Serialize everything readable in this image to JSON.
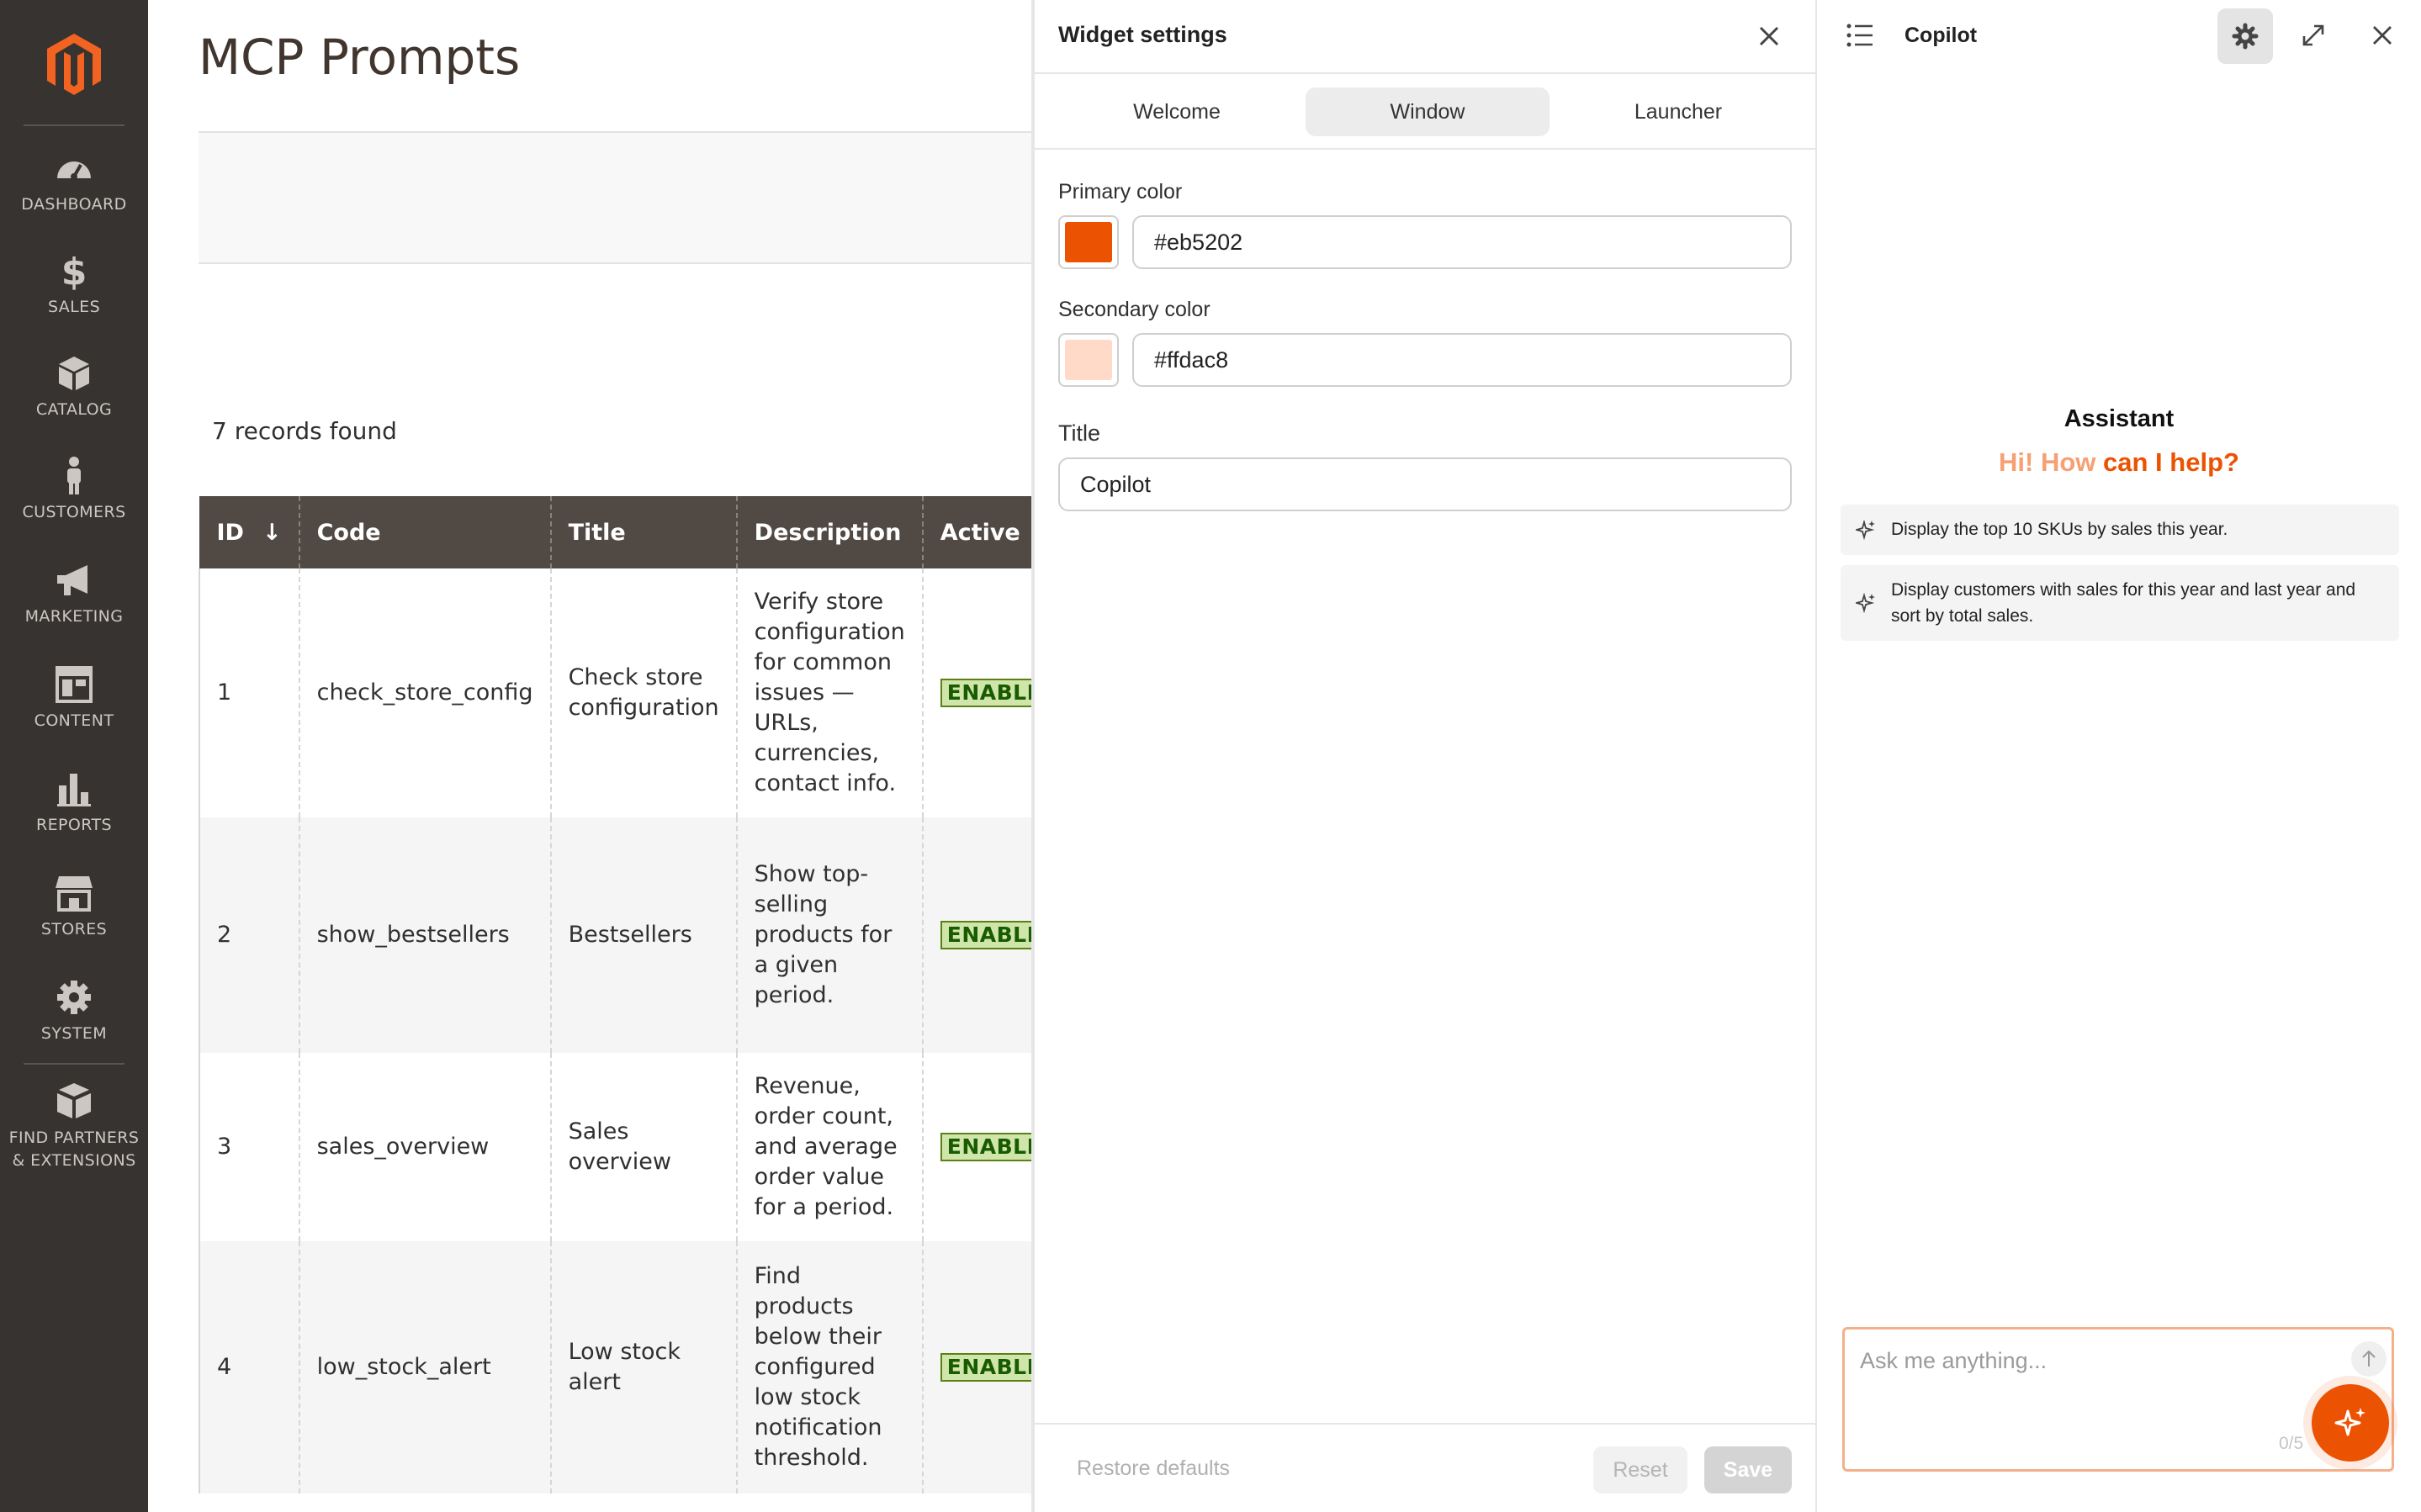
{
  "nav": {
    "items": [
      {
        "label": "DASHBOARD",
        "icon": "dashboard-icon"
      },
      {
        "label": "SALES",
        "icon": "dollar-icon"
      },
      {
        "label": "CATALOG",
        "icon": "box-icon"
      },
      {
        "label": "CUSTOMERS",
        "icon": "person-icon"
      },
      {
        "label": "MARKETING",
        "icon": "megaphone-icon"
      },
      {
        "label": "CONTENT",
        "icon": "layout-icon"
      },
      {
        "label": "REPORTS",
        "icon": "bar-chart-icon"
      },
      {
        "label": "STORES",
        "icon": "storefront-icon"
      },
      {
        "label": "SYSTEM",
        "icon": "gear-icon"
      },
      {
        "label": "FIND PARTNERS & EXTENSIONS",
        "icon": "boxes-icon"
      }
    ]
  },
  "main": {
    "title": "MCP Prompts",
    "records_found": "7 records found",
    "columns": [
      "ID",
      "Code",
      "Title",
      "Description",
      "Active"
    ],
    "rows": [
      {
        "id": "1",
        "code": "check_store_config",
        "title": "Check store configuration",
        "description": "Verify store configuration for common issues — URLs, currencies, contact info.",
        "active": "ENABLED"
      },
      {
        "id": "2",
        "code": "show_bestsellers",
        "title": "Bestsellers",
        "description": "Show top-selling products for a given period.",
        "active": "ENABLED"
      },
      {
        "id": "3",
        "code": "sales_overview",
        "title": "Sales overview",
        "description": "Revenue, order count, and average order value for a period.",
        "active": "ENABLED"
      },
      {
        "id": "4",
        "code": "low_stock_alert",
        "title": "Low stock alert",
        "description": "Find products below their configured low stock notification threshold.",
        "active": "ENABLED"
      }
    ]
  },
  "settings": {
    "title": "Widget settings",
    "tabs": [
      "Welcome",
      "Window",
      "Launcher"
    ],
    "active_tab": "Window",
    "primary_label": "Primary color",
    "primary_value": "#eb5202",
    "secondary_label": "Secondary color",
    "secondary_value": "#ffdac8",
    "title_label": "Title",
    "title_value": "Copilot",
    "restore_label": "Restore defaults",
    "reset_label": "Reset",
    "save_label": "Save"
  },
  "copilot": {
    "title": "Copilot",
    "assistant_label": "Assistant",
    "greeting": "Hi! How can I help?",
    "suggestions": [
      "Display the top 10 SKUs by sales this year.",
      "Display customers with sales for this year and last year and sort by total sales."
    ],
    "input_placeholder": "Ask me anything...",
    "char_counter": "0/5",
    "accent_color": "#eb5202"
  }
}
